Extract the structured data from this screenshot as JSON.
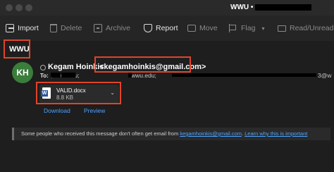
{
  "window": {
    "title": "WWU •"
  },
  "toolbar": {
    "import": "Import",
    "delete": "Delete",
    "archive": "Archive",
    "report": "Report",
    "move": "Move",
    "flag": "Flag",
    "mark": "Read/Unread"
  },
  "message": {
    "subject": "WWU",
    "avatar_initials": "KH",
    "avatar_color": "#3b7d3b",
    "sender_name": "Kegam Hoinkis",
    "sender_email": "<kegamhoinkis@gmail.com>",
    "to_label": "To:",
    "to_part1": "; wwu.edu;",
    "to_part2": "wwu.edu;",
    "to_part3": "3@w",
    "attachment": {
      "name": "VALID.docx",
      "size": "8.8 KB",
      "icon": "word-doc-icon"
    },
    "download_label": "Download",
    "preview_label": "Preview"
  },
  "notice": {
    "prefix": "Some people who received this message don't often get email from ",
    "email": "kegamhoinkis@gmail.com",
    "separator": ". ",
    "learn": "Learn why this is important"
  },
  "colors": {
    "highlight_box": "#e0442a",
    "link": "#4da3ff"
  }
}
